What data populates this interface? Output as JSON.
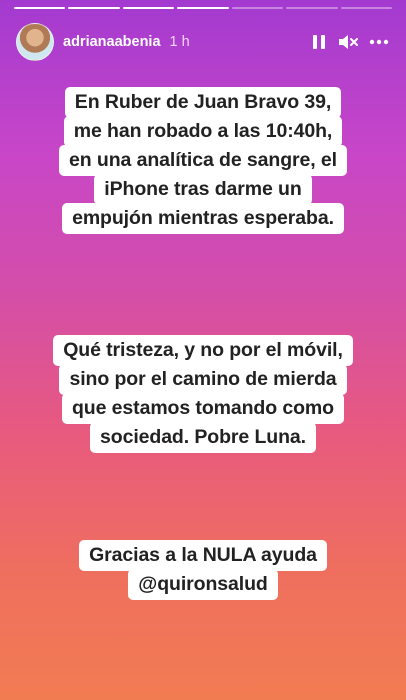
{
  "story": {
    "progress": {
      "total_segments": 7,
      "completed_segments": 4
    },
    "header": {
      "username": "adrianaabenia",
      "time_ago": "1 h"
    },
    "blocks": [
      {
        "lines": [
          "En Ruber de Juan Bravo 39,",
          "me han robado a las 10:40h,",
          "en una analítica de sangre, el",
          "iPhone tras darme un",
          "empujón mientras esperaba."
        ]
      },
      {
        "lines": [
          "Qué tristeza, y no por el móvil,",
          "sino por el camino de mierda",
          "que estamos tomando como",
          "sociedad. Pobre Luna."
        ]
      },
      {
        "lines": [
          "Gracias a la NULA ayuda",
          "@quironsalud"
        ]
      }
    ],
    "controls": [
      "pause-icon",
      "mute-icon",
      "more-icon"
    ],
    "colors": {
      "gradient_top": "#a33ad0",
      "gradient_bottom": "#f27c52",
      "caption_bg": "#ffffff",
      "caption_text": "#222222"
    }
  }
}
